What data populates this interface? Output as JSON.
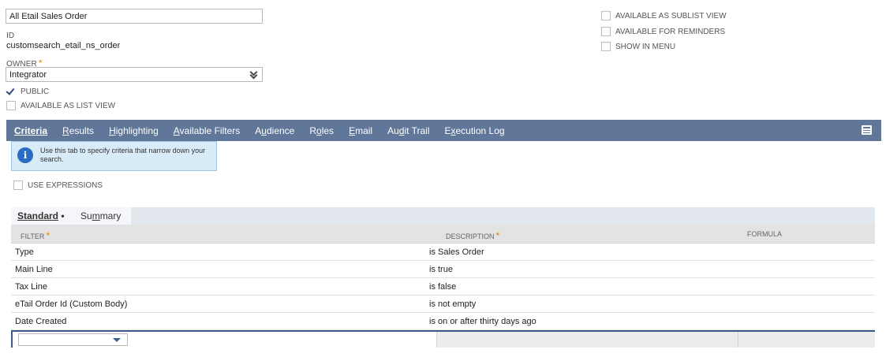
{
  "form": {
    "search_title_value": "All Etail Sales Order",
    "id_label": "ID",
    "id_value": "customsearch_etail_ns_order",
    "owner_label": "OWNER",
    "owner_required": "*",
    "owner_value": "Integrator",
    "public_label": "PUBLIC",
    "list_view_label": "AVAILABLE AS LIST VIEW",
    "sublist_view_label": "AVAILABLE AS SUBLIST VIEW",
    "reminders_label": "AVAILABLE FOR REMINDERS",
    "show_in_menu_label": "SHOW IN MENU",
    "public_checked": true
  },
  "tabs": [
    {
      "label": "Criteria",
      "pre": "",
      "ul": "C",
      "post": "riteria"
    },
    {
      "label": "Results",
      "pre": "",
      "ul": "R",
      "post": "esults"
    },
    {
      "label": "Highlighting",
      "pre": "",
      "ul": "H",
      "post": "ighlighting"
    },
    {
      "label": "Available Filters",
      "pre": "",
      "ul": "A",
      "post": "vailable Filters"
    },
    {
      "label": "Audience",
      "pre": "A",
      "ul": "u",
      "post": "dience"
    },
    {
      "label": "Roles",
      "pre": "R",
      "ul": "o",
      "post": "les"
    },
    {
      "label": "Email",
      "pre": "",
      "ul": "E",
      "post": "mail"
    },
    {
      "label": "Audit Trail",
      "pre": "Au",
      "ul": "d",
      "post": "it Trail"
    },
    {
      "label": "Execution Log",
      "pre": "E",
      "ul": "x",
      "post": "ecution Log"
    }
  ],
  "info": {
    "text_line1": "Use this tab to specify criteria that narrow down your",
    "text_line2": "search."
  },
  "use_expressions_label": "USE EXPRESSIONS",
  "subtabs": {
    "standard": "Standard",
    "standard_dot": "•",
    "summary_pre": "Su",
    "summary_ul": "m",
    "summary_post": "mary"
  },
  "grid": {
    "headers": {
      "filter": "FILTER",
      "description": "DESCRIPTION",
      "formula": "FORMULA",
      "required": "*"
    },
    "rows": [
      {
        "filter": "Type",
        "description": "is Sales Order"
      },
      {
        "filter": "Main Line",
        "description": "is true"
      },
      {
        "filter": "Tax Line",
        "description": "is false"
      },
      {
        "filter": "eTail Order Id (Custom Body)",
        "description": "is not empty"
      },
      {
        "filter": "Date Created",
        "description": "is on or after thirty days ago"
      }
    ]
  }
}
